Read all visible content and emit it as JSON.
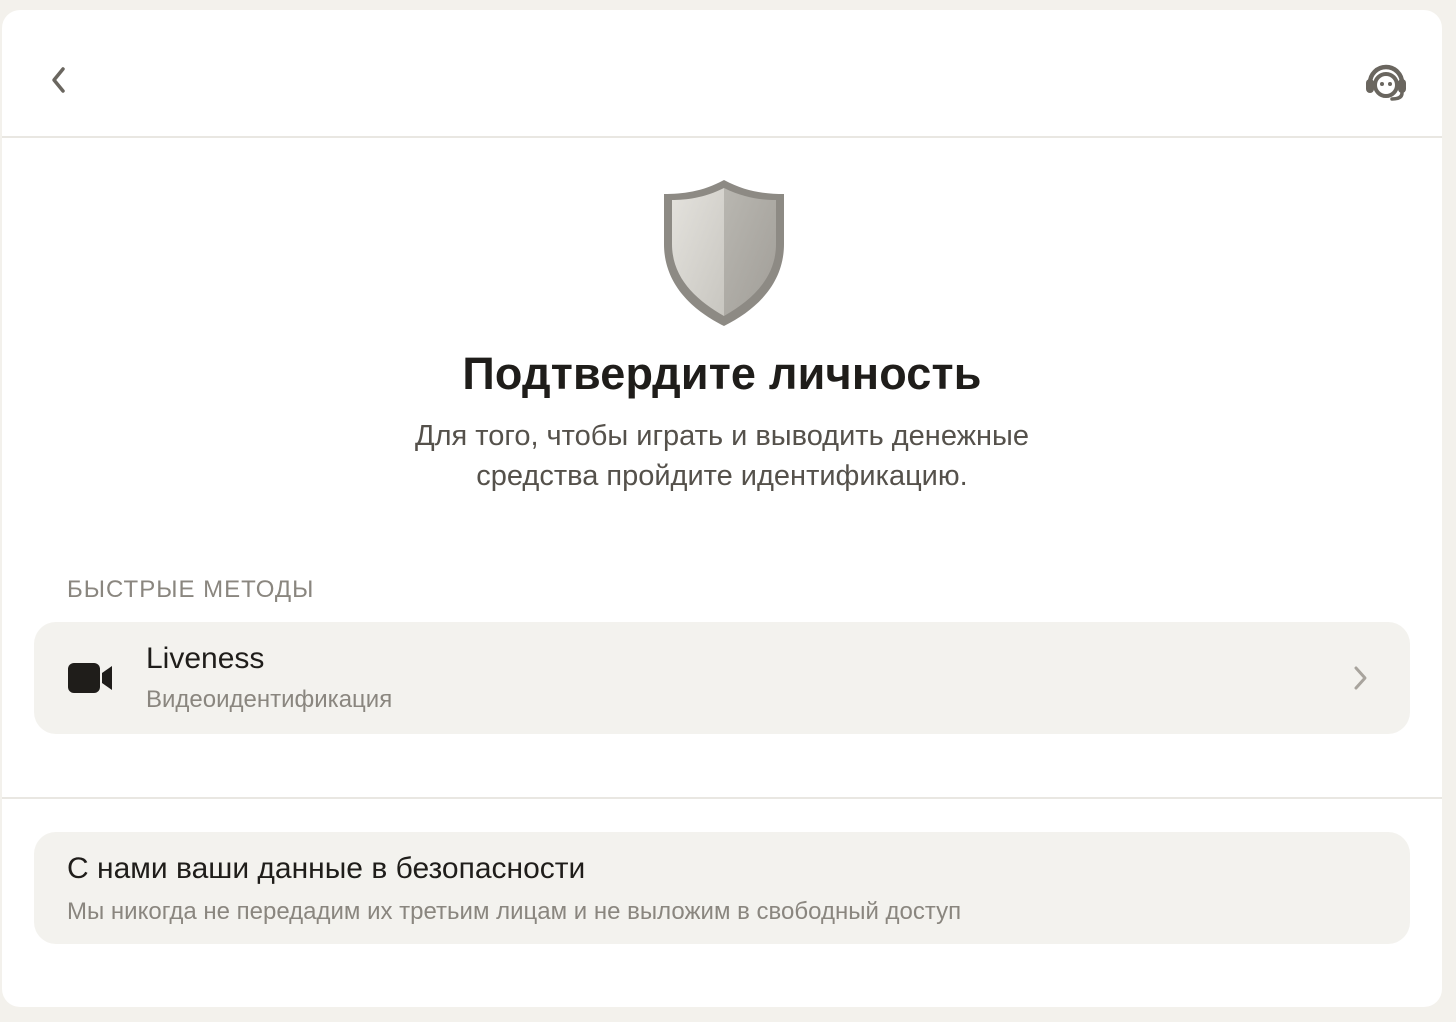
{
  "header": {
    "back_icon": "chevron-left-icon",
    "support_icon": "headset-support-icon"
  },
  "hero": {
    "icon": "shield-icon",
    "title": "Подтвердите личность",
    "subtitle_line1": "Для того, чтобы играть и выводить денежные",
    "subtitle_line2": "средства пройдите идентификацию."
  },
  "methods": {
    "section_label": "БЫСТРЫЕ МЕТОДЫ",
    "items": [
      {
        "icon": "video-camera-icon",
        "title": "Liveness",
        "subtitle": "Видеоидентификация",
        "chevron": "chevron-right-icon"
      }
    ]
  },
  "info": {
    "title": "С нами ваши данные в безопасности",
    "subtitle": "Мы никогда не передадим их третьим лицам и не выложим в свободный доступ"
  },
  "colors": {
    "background": "#f3f1ec",
    "panel": "#ffffff",
    "card": "#f3f2ee",
    "text_primary": "#1f1d1a",
    "text_secondary": "#8a867f"
  }
}
